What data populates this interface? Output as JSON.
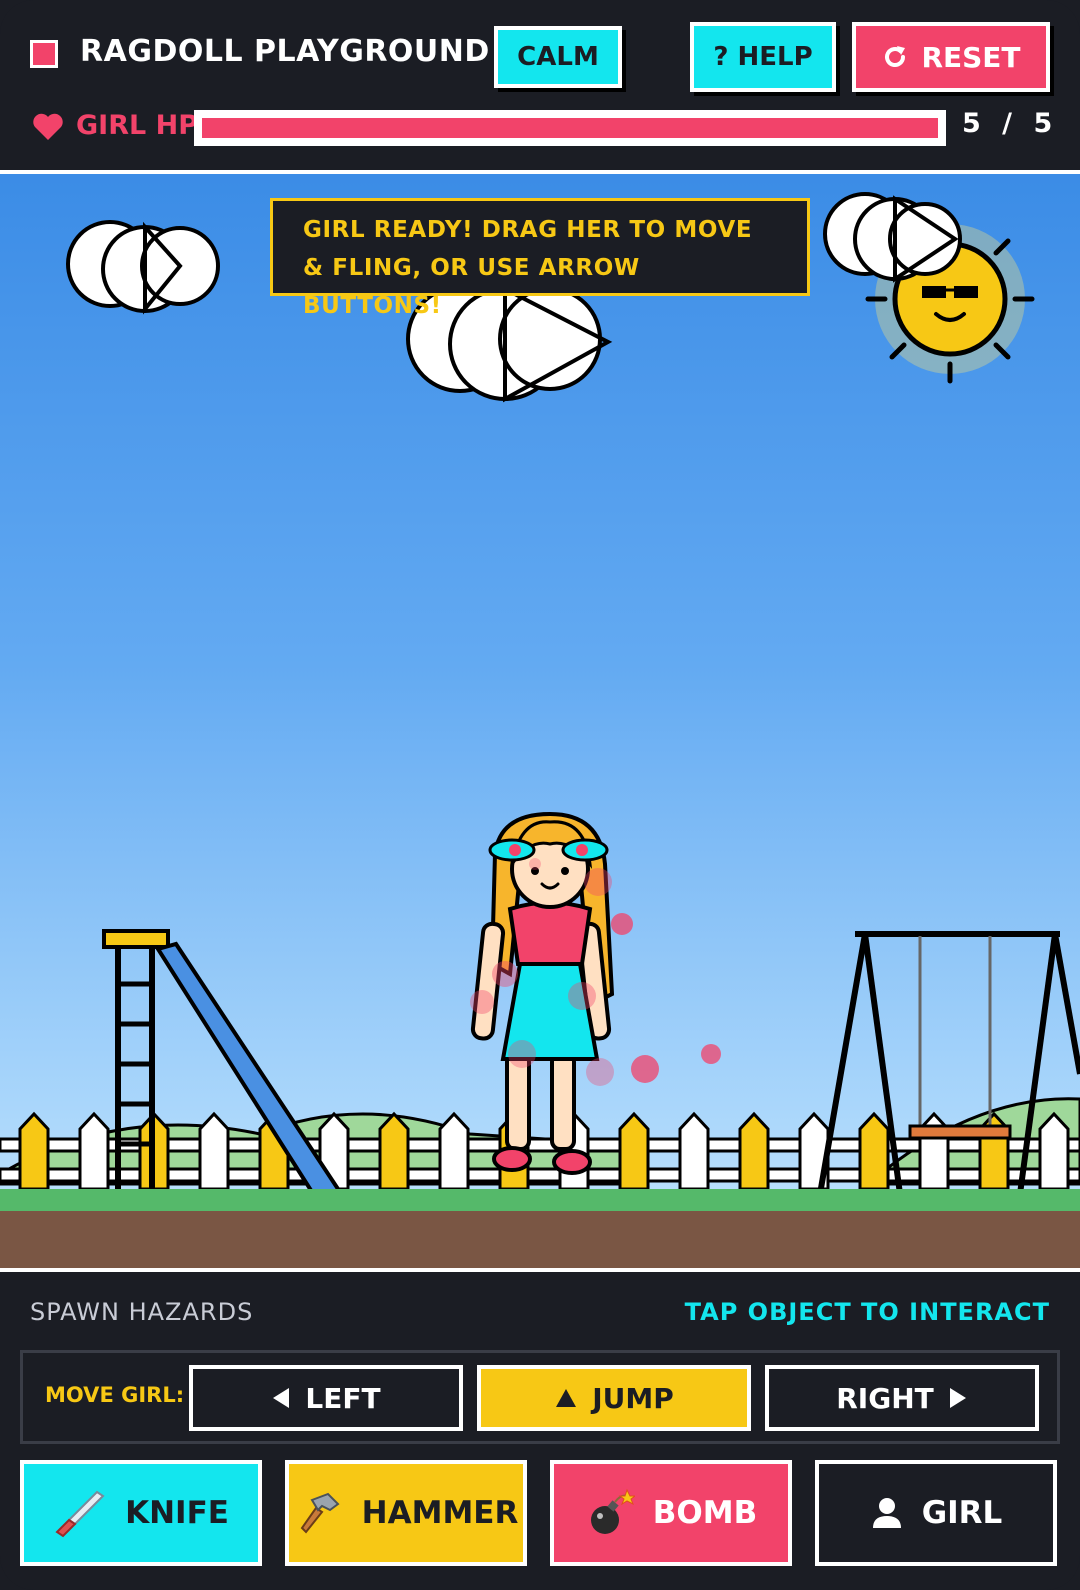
{
  "header": {
    "title": "RAGDOLL PLAYGROUND",
    "calm_label": "CALM",
    "help_label": "? HELP",
    "reset_label": "RESET",
    "reset_icon": "refresh-icon",
    "logo_color": "#f2436a"
  },
  "hp": {
    "label": "GIRL HP",
    "current": 5,
    "max": 5,
    "display": "5 / 5",
    "fill_fraction": 1.0,
    "color": "#f2436a"
  },
  "scene": {
    "toast": "GIRL READY! DRAG HER TO MOVE & FLING, OR USE ARROW BUTTONS!",
    "objects": [
      "cloud",
      "cloud",
      "cloud",
      "sun-with-sunglasses",
      "slide",
      "swing-set",
      "fence",
      "hills",
      "ground",
      "girl-ragdoll"
    ]
  },
  "panel": {
    "spawn_label": "SPAWN HAZARDS",
    "tap_hint": "TAP OBJECT TO INTERACT",
    "move_label": "MOVE GIRL:",
    "left_label": "LEFT",
    "jump_label": "JUMP",
    "right_label": "RIGHT",
    "hazards": [
      {
        "label": "KNIFE",
        "icon": "knife-icon",
        "color": "#13e6ee"
      },
      {
        "label": "HAMMER",
        "icon": "hammer-icon",
        "color": "#f7c815"
      },
      {
        "label": "BOMB",
        "icon": "bomb-icon",
        "color": "#f2436a"
      },
      {
        "label": "GIRL",
        "icon": "person-icon",
        "color": "#1b1d24"
      }
    ]
  },
  "colors": {
    "accent_cyan": "#13e6ee",
    "accent_pink": "#f2436a",
    "accent_yellow": "#f7c815",
    "background": "#1b1d24"
  }
}
